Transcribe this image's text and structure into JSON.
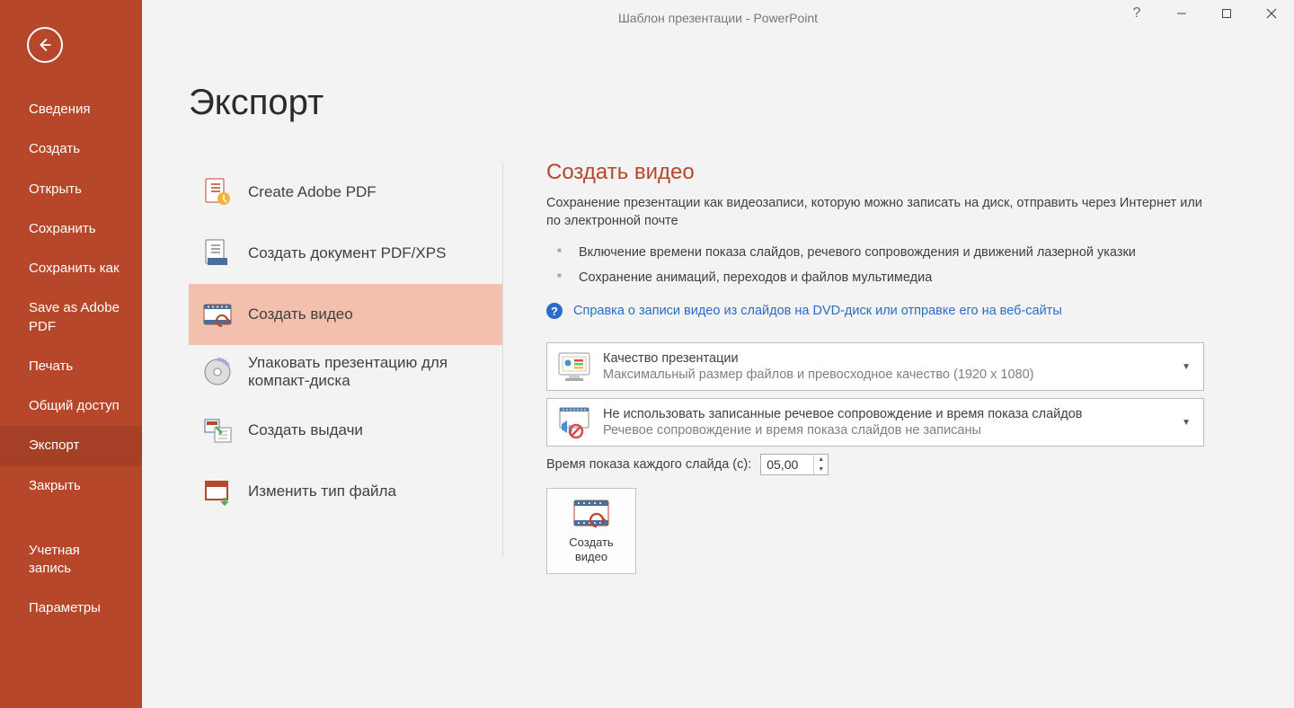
{
  "window": {
    "title": "Шаблон презентации - PowerPoint",
    "help_tooltip": "?"
  },
  "sidebar": {
    "items": [
      {
        "label": "Сведения"
      },
      {
        "label": "Создать"
      },
      {
        "label": "Открыть"
      },
      {
        "label": "Сохранить"
      },
      {
        "label": "Сохранить как"
      },
      {
        "label": "Save as Adobe PDF"
      },
      {
        "label": "Печать"
      },
      {
        "label": "Общий доступ"
      },
      {
        "label": "Экспорт"
      },
      {
        "label": "Закрыть"
      }
    ],
    "footer": [
      {
        "label": "Учетная запись"
      },
      {
        "label": "Параметры"
      }
    ]
  },
  "page": {
    "title": "Экспорт"
  },
  "export_options": [
    {
      "label": "Create Adobe PDF"
    },
    {
      "label": "Создать документ PDF/XPS"
    },
    {
      "label": "Создать видео"
    },
    {
      "label": "Упаковать презентацию для компакт-диска"
    },
    {
      "label": "Создать выдачи"
    },
    {
      "label": "Изменить тип файла"
    }
  ],
  "detail": {
    "title": "Создать видео",
    "description": "Сохранение презентации как видеозаписи, которую можно записать на диск, отправить через Интернет или по электронной почте",
    "bullets": [
      "Включение времени показа слайдов, речевого сопровождения и движений лазерной указки",
      "Сохранение анимаций, переходов и файлов мультимедиа"
    ],
    "help_link": "Справка о записи видео из слайдов на DVD-диск или отправке его на веб-сайты",
    "quality": {
      "title": "Качество презентации",
      "subtitle": "Максимальный размер файлов и превосходное качество (1920 x 1080)"
    },
    "narration": {
      "title": "Не использовать записанные речевое сопровождение и время показа слайдов",
      "subtitle": "Речевое сопровождение и время показа слайдов не записаны"
    },
    "time_label": "Время показа каждого слайда (с):",
    "time_value": "05,00",
    "create_button_line1": "Создать",
    "create_button_line2": "видео"
  }
}
